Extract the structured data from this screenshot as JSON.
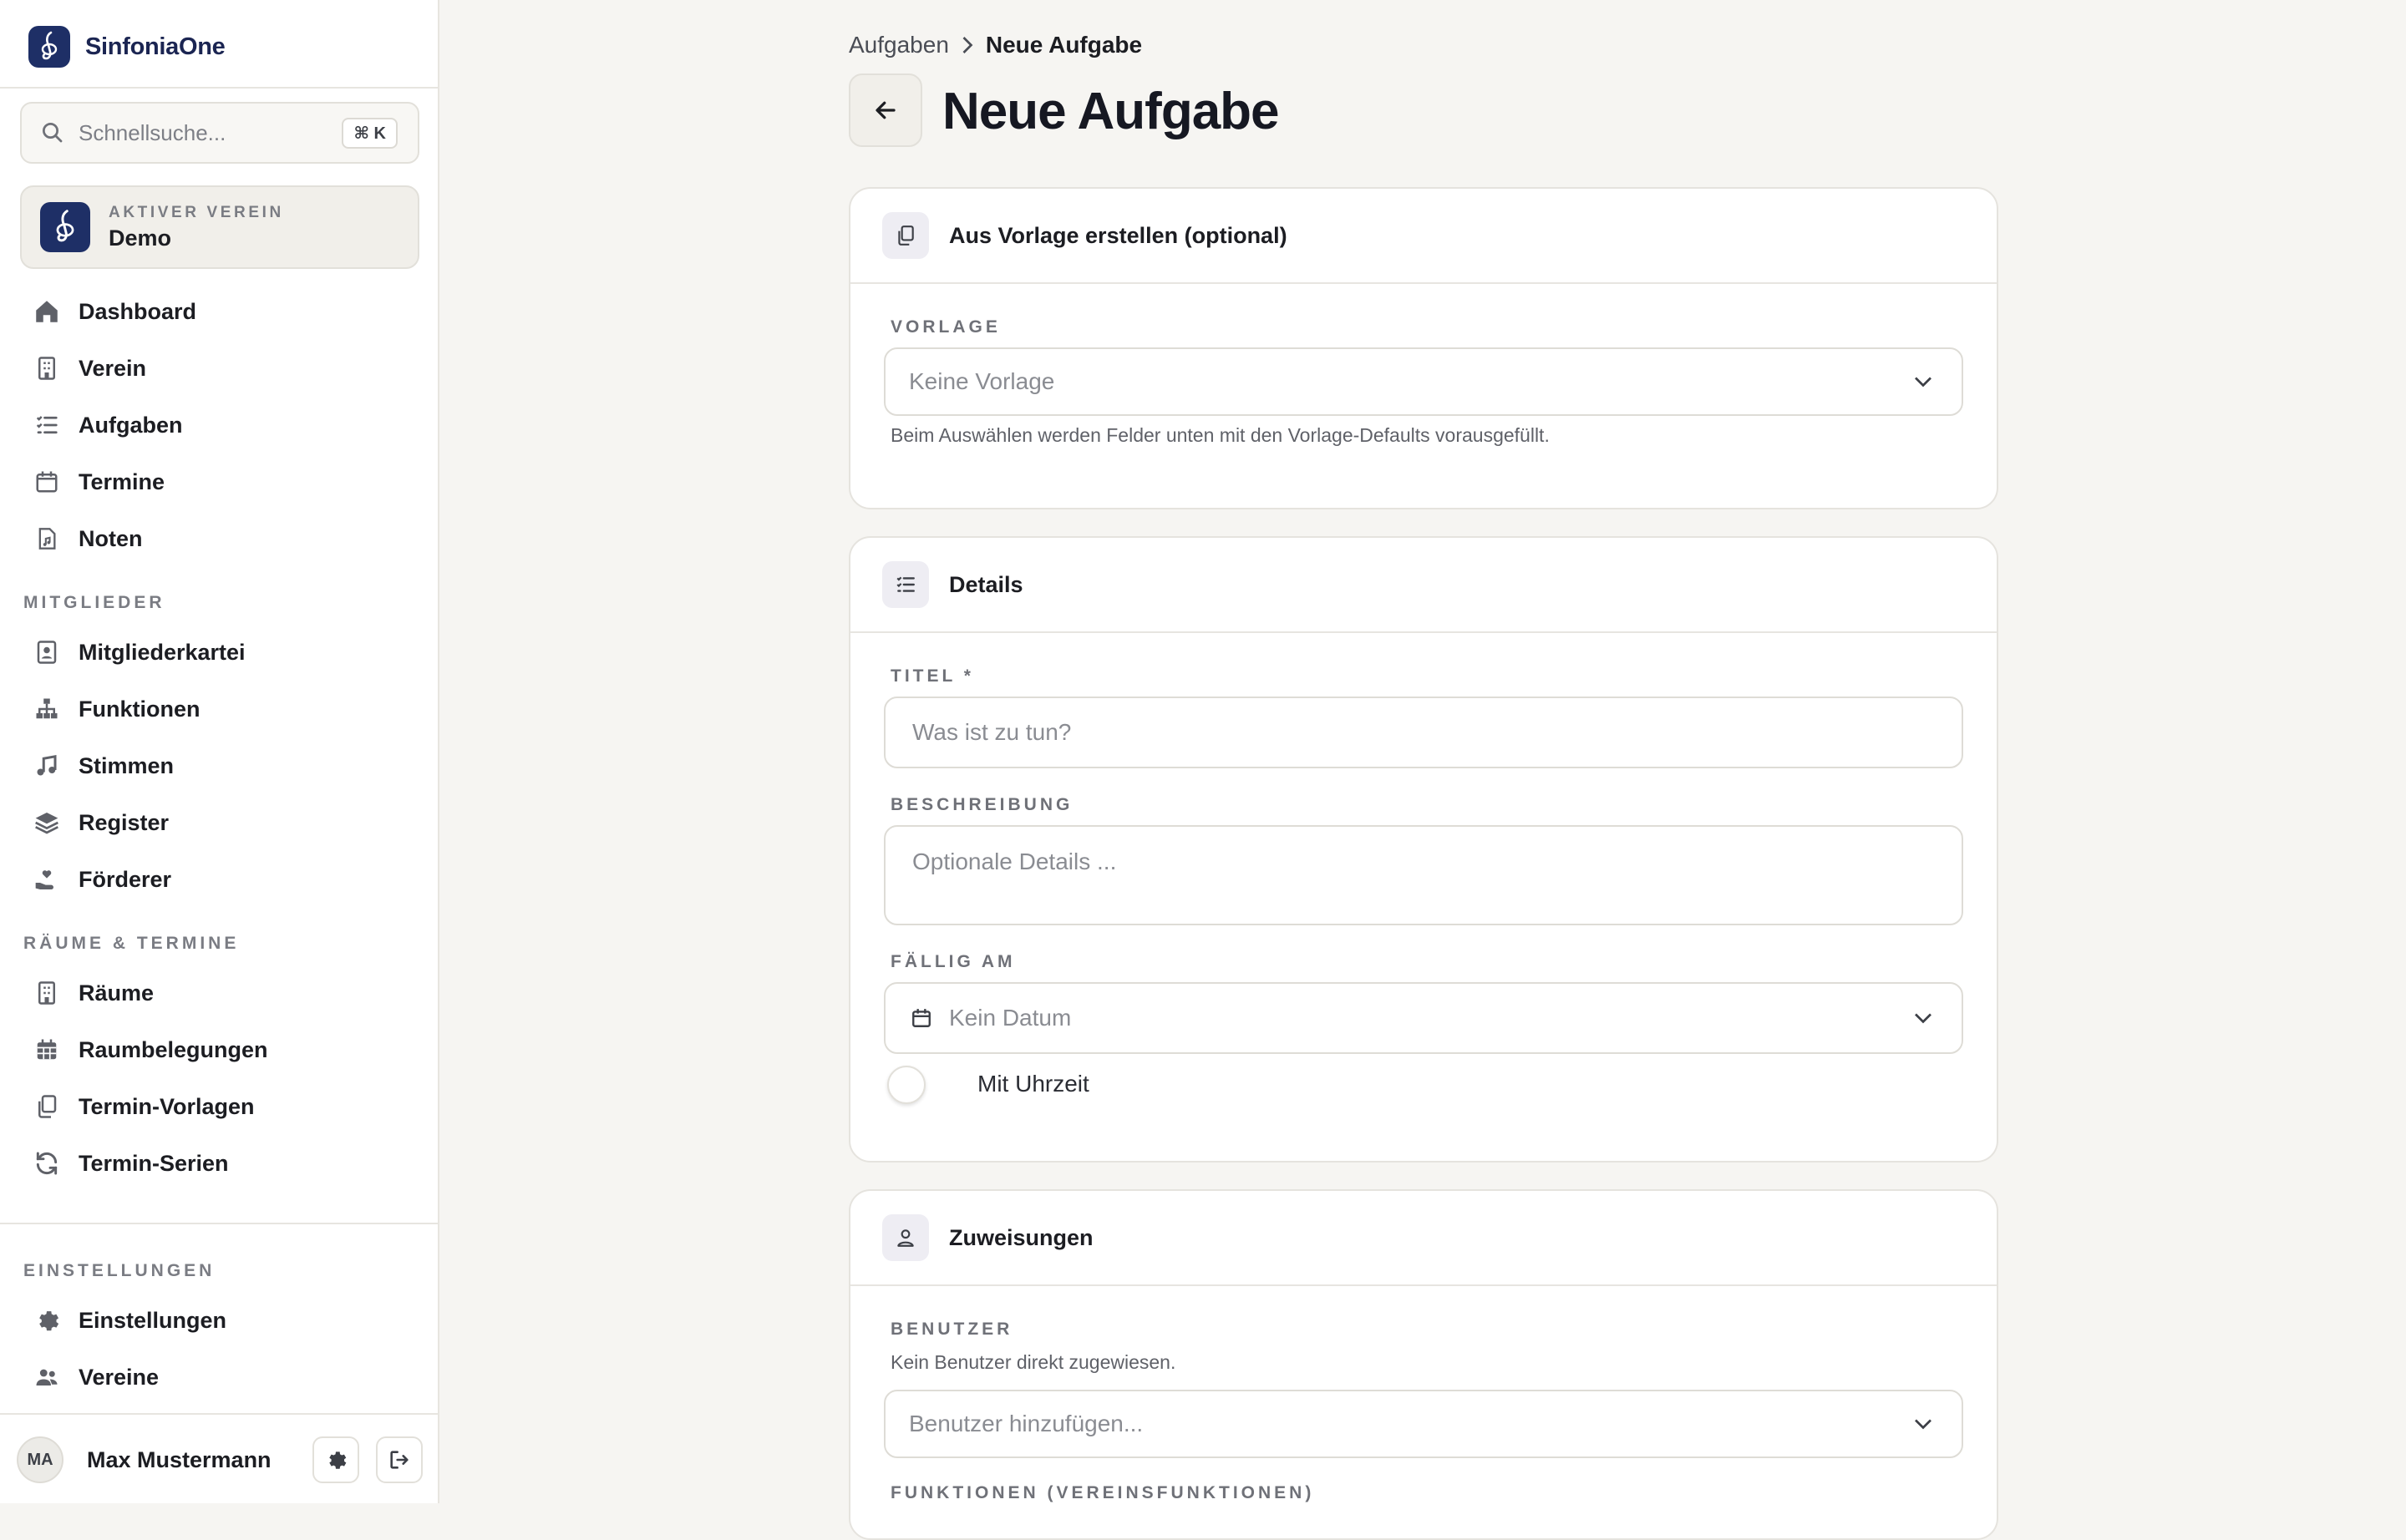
{
  "app": {
    "name": "SinfoniaOne"
  },
  "search": {
    "placeholder": "Schnellsuche...",
    "shortcut": "⌘ K"
  },
  "club": {
    "label": "AKTIVER VEREIN",
    "name": "Demo"
  },
  "nav": {
    "main": [
      {
        "label": "Dashboard",
        "icon": "home-icon"
      },
      {
        "label": "Verein",
        "icon": "building-icon"
      },
      {
        "label": "Aufgaben",
        "icon": "task-list-icon"
      },
      {
        "label": "Termine",
        "icon": "calendar-icon"
      },
      {
        "label": "Noten",
        "icon": "sheet-music-file-icon"
      }
    ],
    "sections": [
      {
        "title": "MITGLIEDER",
        "items": [
          {
            "label": "Mitgliederkartei",
            "icon": "contact-card-icon"
          },
          {
            "label": "Funktionen",
            "icon": "org-chart-icon"
          },
          {
            "label": "Stimmen",
            "icon": "music-note-icon"
          },
          {
            "label": "Register",
            "icon": "layers-icon"
          },
          {
            "label": "Förderer",
            "icon": "hand-heart-icon"
          }
        ]
      },
      {
        "title": "RÄUME & TERMINE",
        "items": [
          {
            "label": "Räume",
            "icon": "building-icon"
          },
          {
            "label": "Raumbelegungen",
            "icon": "calendar-grid-icon"
          },
          {
            "label": "Termin-Vorlagen",
            "icon": "copy-icon"
          },
          {
            "label": "Termin-Serien",
            "icon": "refresh-icon"
          }
        ]
      }
    ],
    "settings": {
      "title": "EINSTELLUNGEN",
      "items": [
        {
          "label": "Einstellungen",
          "icon": "gear-icon"
        },
        {
          "label": "Vereine",
          "icon": "users-icon"
        }
      ]
    }
  },
  "user": {
    "initials": "MA",
    "name": "Max Mustermann"
  },
  "breadcrumb": {
    "parent": "Aufgaben",
    "current": "Neue Aufgabe"
  },
  "page": {
    "title": "Neue Aufgabe"
  },
  "template_card": {
    "title": "Aus Vorlage erstellen (optional)",
    "label": "VORLAGE",
    "value": "Keine Vorlage",
    "hint": "Beim Auswählen werden Felder unten mit den Vorlage-Defaults vorausgefüllt."
  },
  "details_card": {
    "title": "Details",
    "title_label": "TITEL *",
    "title_placeholder": "Was ist zu tun?",
    "desc_label": "BESCHREIBUNG",
    "desc_placeholder": "Optionale Details ...",
    "due_label": "FÄLLIG AM",
    "due_value": "Kein Datum",
    "time_toggle_label": "Mit Uhrzeit",
    "time_toggle_on": false
  },
  "assign_card": {
    "title": "Zuweisungen",
    "users_label": "BENUTZER",
    "users_hint": "Kein Benutzer direkt zugewiesen.",
    "users_placeholder": "Benutzer hinzufügen...",
    "functions_label": "FUNKTIONEN (VEREINSFUNKTIONEN)"
  },
  "colors": {
    "brand": "#1e2f66",
    "background": "#f6f5f2",
    "accent_badge": "#eeedf3"
  }
}
